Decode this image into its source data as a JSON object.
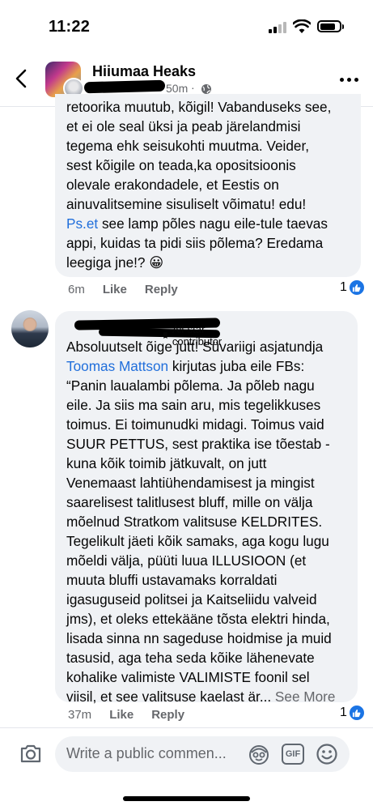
{
  "status_bar": {
    "time": "11:22"
  },
  "header": {
    "group_name": "Hiiumaa Heaks",
    "time_ago": "50m",
    "separator": "·"
  },
  "comments": [
    {
      "lines": [
        "retoorika muutub, kõigil! Vabanduseks see,",
        "et ei ole seal üksi ja peab järelandmisi",
        "tegema ehk seisukohti muutma. Veider,",
        "sest  kõigile on teada,ka opositsioonis",
        "olevale erakondadele, et Eestis on",
        "ainuvalitsemine sisuliselt võimatu! edu!"
      ],
      "link_text": "Ps.et",
      "line_after_link": " see lamp põles nagu eile-tule taevas",
      "lines_end": [
        "appi, kuidas ta pidi siis põlema? Eredama",
        "leegiga jne!? 😀"
      ],
      "time": "6m",
      "like_label": "Like",
      "reply_label": "Reply",
      "reaction_count": "1"
    },
    {
      "badge": "All-star contributor",
      "line_first": "Absoluutselt õige jutt! Süvariigi asjatundja",
      "mention": "Toomas Mattson",
      "after_mention": " kirjutas juba eile FBs:",
      "lines": [
        "“Panin laualambi põlema. Ja põleb nagu",
        "eile. Ja siis ma sain aru, mis tegelikkuses",
        "toimus. Ei toimunudki midagi. Toimus vaid",
        "SUUR PETTUS, sest praktika ise tõestab -",
        "kuna kõik toimib jätkuvalt, on jutt",
        "Venemaast lahtiühendamisest ja mingist",
        "saarelisest talitlusest bluff, mille on välja",
        "mõelnud Stratkom valitsuse KELDRITES.",
        "Tegelikult jäeti kõik samaks, aga kogu lugu",
        "mõeldi välja, püüti luua ILLUSIOON (et",
        "muuta bluffi ustavamaks korraldati",
        "igasuguseid politsei ja Kaitseliidu valveid",
        "jms), et oleks ettekääne tõsta elektri hinda,",
        "lisada sinna nn sageduse hoidmise ja muid",
        "tasusid, aga teha seda kõike lähenevate",
        "kohalike valimiste VALIMISTE foonil sel"
      ],
      "last_line": "viisil, et see valitsuse kaelast är... ",
      "see_more": "See More",
      "time": "37m",
      "like_label": "Like",
      "reply_label": "Reply",
      "reaction_count": "1"
    }
  ],
  "composer": {
    "placeholder": "Write a public commen...",
    "gif_label": "GIF"
  },
  "colors": {
    "link": "#216fdb",
    "like": "#1b74e4",
    "bubble": "#f0f2f5",
    "meta": "#65676b"
  }
}
